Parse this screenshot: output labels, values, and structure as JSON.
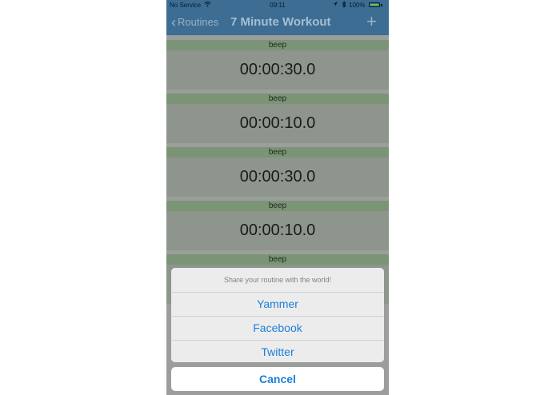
{
  "status_bar": {
    "carrier": "No Service",
    "time": "09:11",
    "battery_percent": "100%",
    "battery_level": 1.0,
    "battery_color": "#6dc24b"
  },
  "nav": {
    "back_label": "Routines",
    "title": "7 Minute Workout",
    "add_icon": "plus-icon",
    "bar_color": "#3d6d93"
  },
  "routine": [
    {
      "label": "beep",
      "time": "00:00:30.0"
    },
    {
      "label": "beep",
      "time": "00:00:10.0"
    },
    {
      "label": "beep",
      "time": "00:00:30.0"
    },
    {
      "label": "beep",
      "time": "00:00:10.0"
    },
    {
      "label": "beep"
    }
  ],
  "share_sheet": {
    "title": "Share your routine with the world!",
    "options": [
      "Yammer",
      "Facebook",
      "Twitter"
    ],
    "cancel_label": "Cancel",
    "accent_color": "#1b7fd8"
  }
}
